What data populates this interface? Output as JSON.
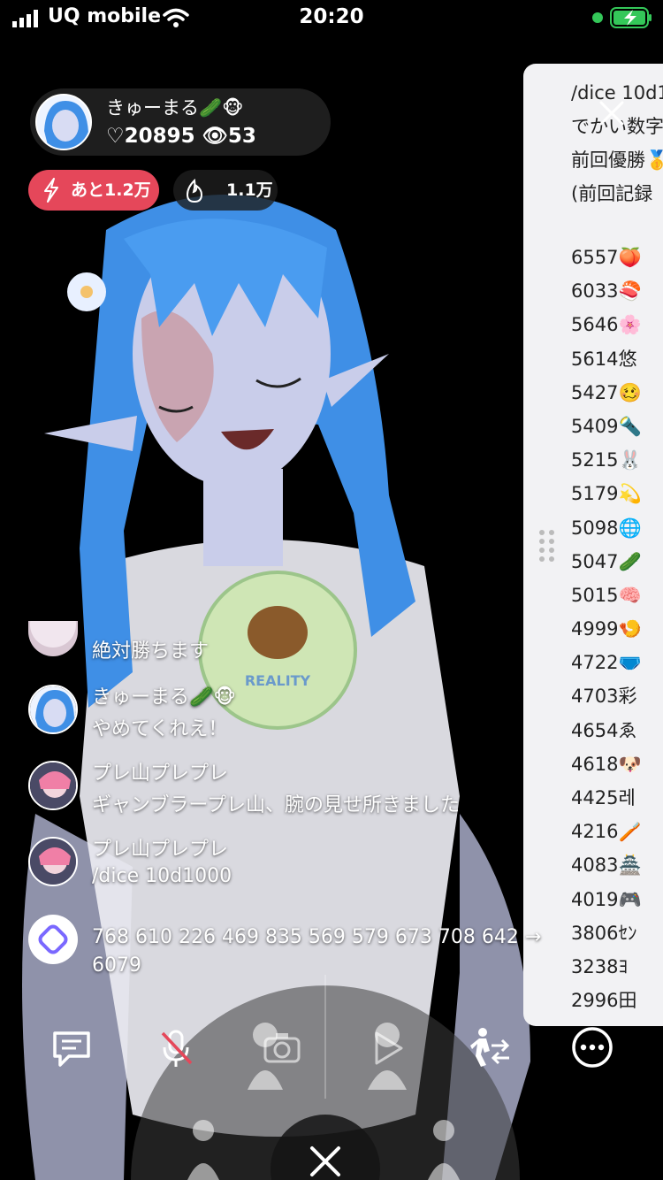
{
  "status_bar": {
    "carrier": "UQ mobile",
    "time": "20:20"
  },
  "host": {
    "name": "きゅーまる🥒🐵",
    "likes": "♡20895",
    "viewers": "53"
  },
  "badges": {
    "remaining": "あと1.2万",
    "fire": "1.1万"
  },
  "side_panel": {
    "header_lines": [
      "/dice 10d1",
      "でかい数字",
      "前回優勝🥇",
      "(前回記録"
    ],
    "scores": [
      "6557🍑",
      "6033🍣",
      "5646🌸",
      "5614悠",
      "5427🥴",
      "5409🔦",
      "5215🐰",
      "5179💫",
      "5098🌐",
      "5047🥒",
      "5015🧠",
      "4999🍤",
      "4722🩲",
      "4703彩",
      "4654ゑ",
      "4618🐶",
      "4425레",
      "4216🪥",
      "4083🏯",
      "4019🎮",
      "3806ｾﾝ",
      "3238ﾖ",
      "2996田"
    ]
  },
  "chat": {
    "messages": [
      {
        "name": "",
        "text": "絶対勝ちます"
      },
      {
        "name": "きゅーまる🥒🐵",
        "text": "やめてくれえ！"
      },
      {
        "name": "プレ山プレプレ",
        "text": "ギャンブラープレ山、腕の見せ所きました"
      },
      {
        "name": "プレ山プレプレ",
        "text": "/dice 10d1000"
      },
      {
        "name": "",
        "text": "768 610 226 469 835 569 579 673 708 642 → 6079"
      }
    ]
  },
  "colors": {
    "accent_red": "#e5475a",
    "panel_bg": "#f2f2f4",
    "hair_blue": "#3f8fe6"
  }
}
